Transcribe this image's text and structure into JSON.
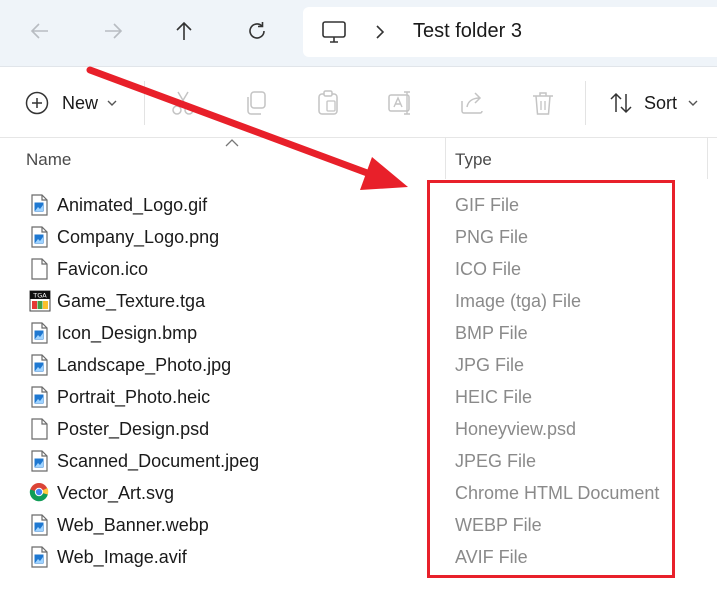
{
  "nav": {
    "back_icon": "arrow-left-icon",
    "forward_icon": "arrow-right-icon",
    "up_icon": "arrow-up-icon",
    "refresh_icon": "refresh-icon",
    "address": {
      "root_icon": "this-pc-icon",
      "crumb": "Test folder 3"
    }
  },
  "toolbar": {
    "new_label": "New",
    "sort_label": "Sort",
    "icons": [
      "cut-icon",
      "copy-icon",
      "paste-icon",
      "rename-icon",
      "share-icon",
      "delete-icon"
    ]
  },
  "columns": {
    "name": "Name",
    "type": "Type"
  },
  "files": [
    {
      "name": "Animated_Logo.gif",
      "type": "GIF File",
      "icon": "image-file-icon"
    },
    {
      "name": "Company_Logo.png",
      "type": "PNG File",
      "icon": "image-file-icon"
    },
    {
      "name": "Favicon.ico",
      "type": "ICO File",
      "icon": "blank-file-icon"
    },
    {
      "name": "Game_Texture.tga",
      "type": "Image (tga) File",
      "icon": "tga-file-icon"
    },
    {
      "name": "Icon_Design.bmp",
      "type": "BMP File",
      "icon": "image-file-icon"
    },
    {
      "name": "Landscape_Photo.jpg",
      "type": "JPG File",
      "icon": "image-file-icon"
    },
    {
      "name": "Portrait_Photo.heic",
      "type": "HEIC File",
      "icon": "image-file-icon"
    },
    {
      "name": "Poster_Design.psd",
      "type": "Honeyview.psd",
      "icon": "blank-file-icon"
    },
    {
      "name": "Scanned_Document.jpeg",
      "type": "JPEG File",
      "icon": "image-file-icon"
    },
    {
      "name": "Vector_Art.svg",
      "type": "Chrome HTML Document",
      "icon": "chrome-icon"
    },
    {
      "name": "Web_Banner.webp",
      "type": "WEBP File",
      "icon": "image-file-icon"
    },
    {
      "name": "Web_Image.avif",
      "type": "AVIF File",
      "icon": "image-file-icon"
    }
  ],
  "annotation": {
    "color": "#e8202a"
  }
}
